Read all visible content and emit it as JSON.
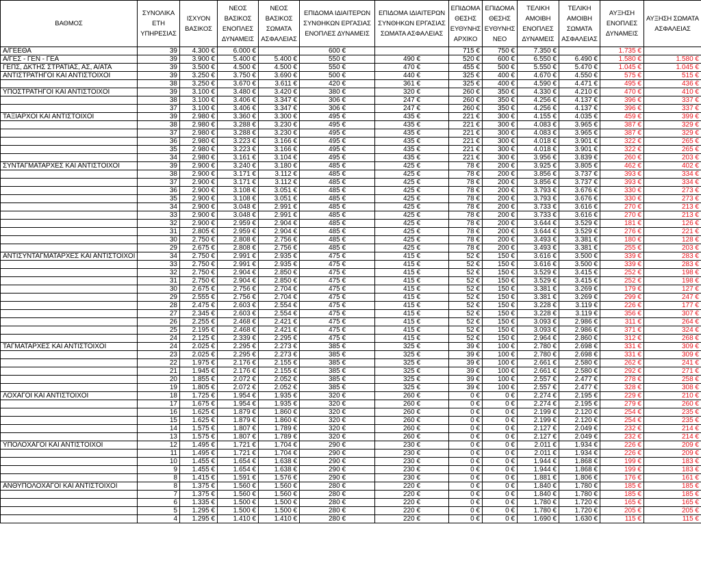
{
  "headers": [
    "ΒΑΘΜΟΣ",
    "ΣΥΝΟΛΙΚΑ ΕΤΗ ΥΠΗΡΕΣΙΑΣ",
    "ΙΣΧΥΟΝ ΒΑΣΙΚΟΣ",
    "ΝΕΟΣ ΒΑΣΙΚΟΣ ΕΝΟΠΛΕΣ ΔΥΝΑΜΕΙΣ",
    "ΝΕΟΣ ΒΑΣΙΚΟΣ ΣΩΜΑΤΑ ΑΣΦΑΛΕΙΑΣ",
    "ΕΠΙΔΟΜΑ ΙΔΙΑΙΤΕΡΩΝ ΣΥΝΘΗΚΩΝ ΕΡΓΑΣΙΑΣ ΕΝΟΠΛΕΣ ΔΥΝΑΜΕΙΣ",
    "ΕΠΙΔΟΜΑ ΙΔΙΑΙΤΕΡΩΝ ΣΥΝΘΗΚΩΝ ΕΡΓΑΣΙΑΣ ΣΩΜΑΤΑ ΑΣΦΑΛΕΙΑΣ",
    "ΕΠΙΔΟΜΑ ΘΕΣΗΣ ΕΥΘΥΝΗΣ ΑΡΧΙΚΟ",
    "ΕΠΙΔΟΜΑ ΘΕΣΗΣ ΕΥΘΥΝΗΣ ΝΕΟ",
    "ΤΕΛΙΚΗ ΑΜΟΙΒΗ ΕΝΟΠΛΕΣ ΔΥΝΑΜΕΙΣ",
    "ΤΕΛΙΚΗ ΑΜΟΙΒΗ ΣΩΜΑΤΑ ΑΣΦΑΛΕΙΑΣ",
    "ΑΥΞΗΣΗ ΕΝΟΠΛΕΣ ΔΥΝΑΜΕΙΣ",
    "ΑΥΞΗΣΗ ΣΩΜΑΤΑ ΑΣΦΑΛΕΙΑΣ"
  ],
  "rows": [
    [
      "Α/ΓΕΕΘΑ",
      "39",
      "4.300 €",
      "6.000 €",
      "",
      "600 €",
      "",
      "715 €",
      "750 €",
      "7.350 €",
      "",
      "1.735 €",
      ""
    ],
    [
      "Α/ΓΕΣ - ΓΕΝ - ΓΕΑ",
      "39",
      "3.900 €",
      "5.400 €",
      "5.400 €",
      "550 €",
      "490 €",
      "520 €",
      "600 €",
      "6.550 €",
      "6.490 €",
      "1.580 €",
      "1.580 €"
    ],
    [
      "ΓΕΠΣ, ΔΚΤΗΣ ΣΤΡΑΤΙΑΣ, ΑΣ, Α/ΑΤΑ",
      "39",
      "3.500 €",
      "4.500 €",
      "4.500 €",
      "550 €",
      "470 €",
      "455 €",
      "500 €",
      "5.550 €",
      "5.470 €",
      "1.045 €",
      "1.045 €"
    ],
    [
      "ΑΝΤΙΣΤΡΑΤΗΓΟΙ ΚΑΙ ΑΝΤΙΣΤΟΙΧΟΙ",
      "39",
      "3.250 €",
      "3.750 €",
      "3.690 €",
      "500 €",
      "440 €",
      "325 €",
      "400 €",
      "4.670 €",
      "4.550 €",
      "575 €",
      "515 €"
    ],
    [
      "",
      "38",
      "3.250 €",
      "3.670 €",
      "3.611 €",
      "420 €",
      "361 €",
      "325 €",
      "400 €",
      "4.590 €",
      "4.471 €",
      "495 €",
      "436 €"
    ],
    [
      "ΥΠΟΣΤΡΑΤΗΓΟΙ ΚΑΙ ΑΝΤΙΣΤΟΙΧΟΙ",
      "39",
      "3.100 €",
      "3.480 €",
      "3.420 €",
      "380 €",
      "320 €",
      "260 €",
      "350 €",
      "4.330 €",
      "4.210 €",
      "470 €",
      "410 €"
    ],
    [
      "",
      "38",
      "3.100 €",
      "3.406 €",
      "3.347 €",
      "306 €",
      "247 €",
      "260 €",
      "350 €",
      "4.256 €",
      "4.137 €",
      "396 €",
      "337 €"
    ],
    [
      "",
      "37",
      "3.100 €",
      "3.406 €",
      "3.347 €",
      "306 €",
      "247 €",
      "260 €",
      "350 €",
      "4.256 €",
      "4.137 €",
      "396 €",
      "337 €"
    ],
    [
      "ΤΑΞΙΑΡΧΟΙ ΚΑΙ ΑΝΤΙΣΤΟΙΧΟΙ",
      "39",
      "2.980 €",
      "3.360 €",
      "3.300 €",
      "495 €",
      "435 €",
      "221 €",
      "300 €",
      "4.155 €",
      "4.035 €",
      "459 €",
      "399 €"
    ],
    [
      "",
      "38",
      "2.980 €",
      "3.288 €",
      "3.230 €",
      "495 €",
      "435 €",
      "221 €",
      "300 €",
      "4.083 €",
      "3.965 €",
      "387 €",
      "329 €"
    ],
    [
      "",
      "37",
      "2.980 €",
      "3.288 €",
      "3.230 €",
      "495 €",
      "435 €",
      "221 €",
      "300 €",
      "4.083 €",
      "3.965 €",
      "387 €",
      "329 €"
    ],
    [
      "",
      "36",
      "2.980 €",
      "3.223 €",
      "3.166 €",
      "495 €",
      "435 €",
      "221 €",
      "300 €",
      "4.018 €",
      "3.901 €",
      "322 €",
      "265 €"
    ],
    [
      "",
      "35",
      "2.980 €",
      "3.223 €",
      "3.166 €",
      "495 €",
      "435 €",
      "221 €",
      "300 €",
      "4.018 €",
      "3.901 €",
      "322 €",
      "265 €"
    ],
    [
      "",
      "34",
      "2.980 €",
      "3.161 €",
      "3.104 €",
      "495 €",
      "435 €",
      "221 €",
      "300 €",
      "3.956 €",
      "3.839 €",
      "260 €",
      "203 €"
    ],
    [
      "ΣΥΝΤΑΓΜΑΤΑΡΧΕΣ ΚΑΙ ΑΝΤΙΣΤΟΙΧΟΙ",
      "39",
      "2.900 €",
      "3.240 €",
      "3.180 €",
      "485 €",
      "425 €",
      "78 €",
      "200 €",
      "3.925 €",
      "3.805 €",
      "462 €",
      "402 €"
    ],
    [
      "",
      "38",
      "2.900 €",
      "3.171 €",
      "3.112 €",
      "485 €",
      "425 €",
      "78 €",
      "200 €",
      "3.856 €",
      "3.737 €",
      "393 €",
      "334 €"
    ],
    [
      "",
      "37",
      "2.900 €",
      "3.171 €",
      "3.112 €",
      "485 €",
      "425 €",
      "78 €",
      "200 €",
      "3.856 €",
      "3.737 €",
      "393 €",
      "334 €"
    ],
    [
      "",
      "36",
      "2.900 €",
      "3.108 €",
      "3.051 €",
      "485 €",
      "425 €",
      "78 €",
      "200 €",
      "3.793 €",
      "3.676 €",
      "330 €",
      "273 €"
    ],
    [
      "",
      "35",
      "2.900 €",
      "3.108 €",
      "3.051 €",
      "485 €",
      "425 €",
      "78 €",
      "200 €",
      "3.793 €",
      "3.676 €",
      "330 €",
      "273 €"
    ],
    [
      "",
      "34",
      "2.900 €",
      "3.048 €",
      "2.991 €",
      "485 €",
      "425 €",
      "78 €",
      "200 €",
      "3.733 €",
      "3.616 €",
      "270 €",
      "213 €"
    ],
    [
      "",
      "33",
      "2.900 €",
      "3.048 €",
      "2.991 €",
      "485 €",
      "425 €",
      "78 €",
      "200 €",
      "3.733 €",
      "3.616 €",
      "270 €",
      "213 €"
    ],
    [
      "",
      "32",
      "2.900 €",
      "2.959 €",
      "2.904 €",
      "485 €",
      "425 €",
      "78 €",
      "200 €",
      "3.644 €",
      "3.529 €",
      "181 €",
      "126 €"
    ],
    [
      "",
      "31",
      "2.805 €",
      "2.959 €",
      "2.904 €",
      "485 €",
      "425 €",
      "78 €",
      "200 €",
      "3.644 €",
      "3.529 €",
      "276 €",
      "221 €"
    ],
    [
      "",
      "30",
      "2.750 €",
      "2.808 €",
      "2.756 €",
      "485 €",
      "425 €",
      "78 €",
      "200 €",
      "3.493 €",
      "3.381 €",
      "180 €",
      "128 €"
    ],
    [
      "",
      "29",
      "2.675 €",
      "2.808 €",
      "2.756 €",
      "485 €",
      "425 €",
      "78 €",
      "200 €",
      "3.493 €",
      "3.381 €",
      "255 €",
      "203 €"
    ],
    [
      "ΑΝΤΙΣΥΝΤΑΓΜΑΤΑΡΧΕΣ ΚΑΙ ΑΝΤΙΣΤΟΙΧΟΙ",
      "34",
      "2.750 €",
      "2.991 €",
      "2.935 €",
      "475 €",
      "415 €",
      "52 €",
      "150 €",
      "3.616 €",
      "3.500 €",
      "339 €",
      "283 €"
    ],
    [
      "",
      "33",
      "2.750 €",
      "2.991 €",
      "2.935 €",
      "475 €",
      "415 €",
      "52 €",
      "150 €",
      "3.616 €",
      "3.500 €",
      "339 €",
      "283 €"
    ],
    [
      "",
      "32",
      "2.750 €",
      "2.904 €",
      "2.850 €",
      "475 €",
      "415 €",
      "52 €",
      "150 €",
      "3.529 €",
      "3.415 €",
      "252 €",
      "198 €"
    ],
    [
      "",
      "31",
      "2.750 €",
      "2.904 €",
      "2.850 €",
      "475 €",
      "415 €",
      "52 €",
      "150 €",
      "3.529 €",
      "3.415 €",
      "252 €",
      "198 €"
    ],
    [
      "",
      "30",
      "2.675 €",
      "2.756 €",
      "2.704 €",
      "475 €",
      "415 €",
      "52 €",
      "150 €",
      "3.381 €",
      "3.269 €",
      "179 €",
      "127 €"
    ],
    [
      "",
      "29",
      "2.555 €",
      "2.756 €",
      "2.704 €",
      "475 €",
      "415 €",
      "52 €",
      "150 €",
      "3.381 €",
      "3.269 €",
      "299 €",
      "247 €"
    ],
    [
      "",
      "28",
      "2.475 €",
      "2.603 €",
      "2.554 €",
      "475 €",
      "415 €",
      "52 €",
      "150 €",
      "3.228 €",
      "3.119 €",
      "226 €",
      "177 €"
    ],
    [
      "",
      "27",
      "2.345 €",
      "2.603 €",
      "2.554 €",
      "475 €",
      "415 €",
      "52 €",
      "150 €",
      "3.228 €",
      "3.119 €",
      "356 €",
      "307 €"
    ],
    [
      "",
      "26",
      "2.255 €",
      "2.468 €",
      "2.421 €",
      "475 €",
      "415 €",
      "52 €",
      "150 €",
      "3.093 €",
      "2.986 €",
      "311 €",
      "264 €"
    ],
    [
      "",
      "25",
      "2.195 €",
      "2.468 €",
      "2.421 €",
      "475 €",
      "415 €",
      "52 €",
      "150 €",
      "3.093 €",
      "2.986 €",
      "371 €",
      "324 €"
    ],
    [
      "",
      "24",
      "2.125 €",
      "2.339 €",
      "2.295 €",
      "475 €",
      "415 €",
      "52 €",
      "150 €",
      "2.964 €",
      "2.860 €",
      "312 €",
      "268 €"
    ],
    [
      "ΤΑΓΜΑΤΑΡΧΕΣ ΚΑΙ ΑΝΤΙΣΤΟΙΧΟΙ",
      "24",
      "2.025 €",
      "2.295 €",
      "2.273 €",
      "385 €",
      "325 €",
      "39 €",
      "100 €",
      "2.780 €",
      "2.698 €",
      "331 €",
      "309 €"
    ],
    [
      "",
      "23",
      "2.025 €",
      "2.295 €",
      "2.273 €",
      "385 €",
      "325 €",
      "39 €",
      "100 €",
      "2.780 €",
      "2.698 €",
      "331 €",
      "309 €"
    ],
    [
      "",
      "22",
      "1.975 €",
      "2.176 €",
      "2.155 €",
      "385 €",
      "325 €",
      "39 €",
      "100 €",
      "2.661 €",
      "2.580 €",
      "262 €",
      "241 €"
    ],
    [
      "",
      "21",
      "1.945 €",
      "2.176 €",
      "2.155 €",
      "385 €",
      "325 €",
      "39 €",
      "100 €",
      "2.661 €",
      "2.580 €",
      "292 €",
      "271 €"
    ],
    [
      "",
      "20",
      "1.855 €",
      "2.072 €",
      "2.052 €",
      "385 €",
      "325 €",
      "39 €",
      "100 €",
      "2.557 €",
      "2.477 €",
      "278 €",
      "258 €"
    ],
    [
      "",
      "19",
      "1.805 €",
      "2.072 €",
      "2.052 €",
      "385 €",
      "325 €",
      "39 €",
      "100 €",
      "2.557 €",
      "2.477 €",
      "328 €",
      "308 €"
    ],
    [
      "ΛΟΧΑΓΟΙ ΚΑΙ ΑΝΤΙΣΤΟΙΧΟΙ",
      "18",
      "1.725 €",
      "1.954 €",
      "1.935 €",
      "320 €",
      "260 €",
      "0 €",
      "0 €",
      "2.274 €",
      "2.195 €",
      "229 €",
      "210 €"
    ],
    [
      "",
      "17",
      "1.675 €",
      "1.954 €",
      "1.935 €",
      "320 €",
      "260 €",
      "0 €",
      "0 €",
      "2.274 €",
      "2.195 €",
      "279 €",
      "260 €"
    ],
    [
      "",
      "16",
      "1.625 €",
      "1.879 €",
      "1.860 €",
      "320 €",
      "260 €",
      "0 €",
      "0 €",
      "2.199 €",
      "2.120 €",
      "254 €",
      "235 €"
    ],
    [
      "",
      "15",
      "1.625 €",
      "1.879 €",
      "1.860 €",
      "320 €",
      "260 €",
      "0 €",
      "0 €",
      "2.199 €",
      "2.120 €",
      "254 €",
      "235 €"
    ],
    [
      "",
      "14",
      "1.575 €",
      "1.807 €",
      "1.789 €",
      "320 €",
      "260 €",
      "0 €",
      "0 €",
      "2.127 €",
      "2.049 €",
      "232 €",
      "214 €"
    ],
    [
      "",
      "13",
      "1.575 €",
      "1.807 €",
      "1.789 €",
      "320 €",
      "260 €",
      "0 €",
      "0 €",
      "2.127 €",
      "2.049 €",
      "232 €",
      "214 €"
    ],
    [
      "ΥΠΟΛΟΧΑΓΟΙ ΚΑΙ ΑΝΤΙΣΤΟΙΧΟΙ",
      "12",
      "1.495 €",
      "1.721 €",
      "1.704 €",
      "290 €",
      "230 €",
      "0 €",
      "0 €",
      "2.011 €",
      "1.934 €",
      "226 €",
      "209 €"
    ],
    [
      "",
      "11",
      "1.495 €",
      "1.721 €",
      "1.704 €",
      "290 €",
      "230 €",
      "0 €",
      "0 €",
      "2.011 €",
      "1.934 €",
      "226 €",
      "209 €"
    ],
    [
      "",
      "10",
      "1.455 €",
      "1.654 €",
      "1.638 €",
      "290 €",
      "230 €",
      "0 €",
      "0 €",
      "1.944 €",
      "1.868 €",
      "199 €",
      "183 €"
    ],
    [
      "",
      "9",
      "1.455 €",
      "1.654 €",
      "1.638 €",
      "290 €",
      "230 €",
      "0 €",
      "0 €",
      "1.944 €",
      "1.868 €",
      "199 €",
      "183 €"
    ],
    [
      "",
      "8",
      "1.415 €",
      "1.591 €",
      "1.576 €",
      "290 €",
      "230 €",
      "0 €",
      "0 €",
      "1.881 €",
      "1.806 €",
      "176 €",
      "161 €"
    ],
    [
      "ΑΝΘΥΠΟΛΟΧΑΓΟΙ ΚΑΙ ΑΝΤΙΣΤΟΙΧΟΙ",
      "8",
      "1.375 €",
      "1.560 €",
      "1.560 €",
      "280 €",
      "220 €",
      "0 €",
      "0 €",
      "1.840 €",
      "1.780 €",
      "185 €",
      "185 €"
    ],
    [
      "",
      "7",
      "1.375 €",
      "1.560 €",
      "1.560 €",
      "280 €",
      "220 €",
      "0 €",
      "0 €",
      "1.840 €",
      "1.780 €",
      "185 €",
      "185 €"
    ],
    [
      "",
      "6",
      "1.335 €",
      "1.500 €",
      "1.500 €",
      "280 €",
      "220 €",
      "0 €",
      "0 €",
      "1.780 €",
      "1.720 €",
      "165 €",
      "165 €"
    ],
    [
      "",
      "5",
      "1.295 €",
      "1.500 €",
      "1.500 €",
      "280 €",
      "220 €",
      "0 €",
      "0 €",
      "1.780 €",
      "1.720 €",
      "205 €",
      "205 €"
    ],
    [
      "",
      "4",
      "1.295 €",
      "1.410 €",
      "1.410 €",
      "280 €",
      "220 €",
      "0 €",
      "0 €",
      "1.690 €",
      "1.630 €",
      "115 €",
      "115 €"
    ]
  ]
}
